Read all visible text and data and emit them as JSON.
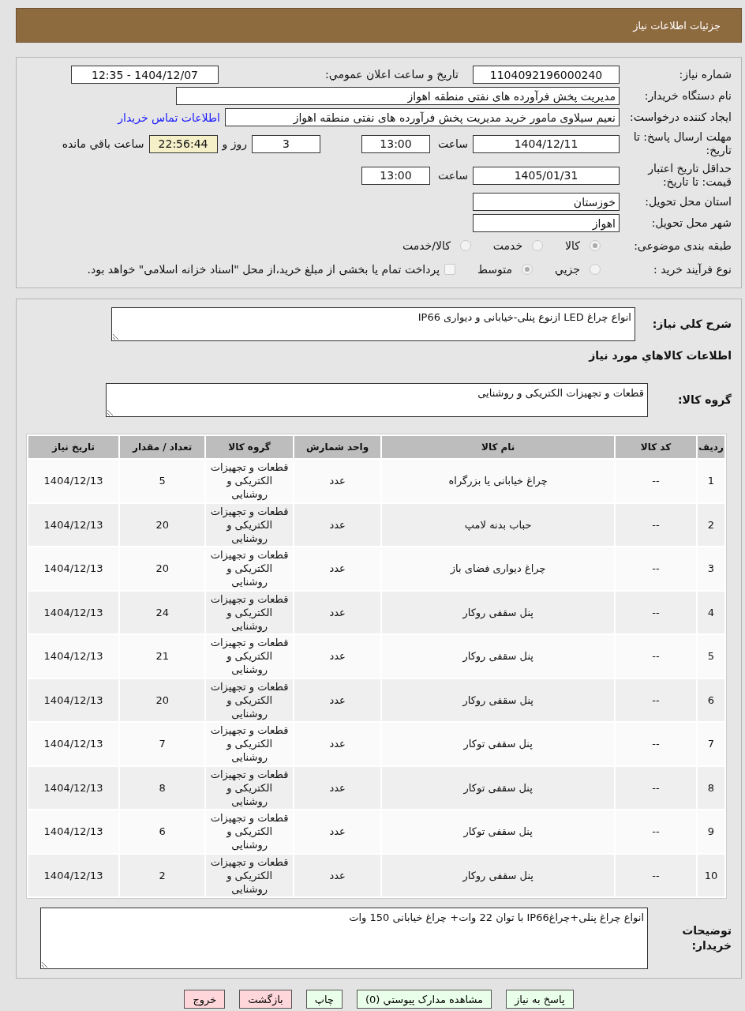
{
  "header": {
    "title": "جزئیات اطلاعات نیاز"
  },
  "need_number": {
    "label": "شماره نیاز:",
    "value": "1104092196000240"
  },
  "announce": {
    "label": "تاریخ و ساعت اعلان عمومي:",
    "value": "1404/12/07 - 12:35"
  },
  "buyer_org": {
    "label": "نام دستگاه خریدار:",
    "value": "مدیریت پخش فرآورده های نفتی منطقه اهواز"
  },
  "requester": {
    "label": "ایجاد کننده درخواست:",
    "value": "نعیم سیلاوی مامور خرید مدیریت پخش فرآورده های نفتی منطقه اهواز",
    "link": "اطلاعات تماس خریدار"
  },
  "deadline": {
    "label": "مهلت ارسال پاسخ: تا تاریخ:",
    "date": "1404/12/11",
    "time_label": "ساعت",
    "time": "13:00",
    "days": "3",
    "days_suffix": "روز و",
    "remaining": "22:56:44",
    "remaining_suffix": "ساعت باقي مانده"
  },
  "validity": {
    "label": "حداقل تاریخ اعتبار قیمت: تا تاریخ:",
    "date": "1405/01/31",
    "time_label": "ساعت",
    "time": "13:00"
  },
  "province": {
    "label": "استان محل تحویل:",
    "value": "خوزستان"
  },
  "city": {
    "label": "شهر محل تحویل:",
    "value": "اهواز"
  },
  "category": {
    "label": "طبقه بندی موضوعی:",
    "options": [
      {
        "label": "کالا",
        "selected": true
      },
      {
        "label": "خدمت",
        "selected": false
      },
      {
        "label": "کالا/خدمت",
        "selected": false
      }
    ]
  },
  "process": {
    "label": "نوع فرآیند خرید :",
    "options": [
      {
        "label": "جزيي",
        "selected": false
      },
      {
        "label": "متوسط",
        "selected": true
      }
    ],
    "checkbox": {
      "checked": false,
      "text": "پرداخت تمام یا بخشی از مبلغ خرید،از محل \"اسناد خزانه اسلامی\" خواهد بود."
    }
  },
  "description": {
    "label": "شرح کلي نیاز:",
    "value": "انواع چراغ LED ازنوع پنلی-خیابانی و دیواری IP66"
  },
  "items_title": "اطلاعات کالاهاي مورد نیاز",
  "goods_group": {
    "label": "گروه کالا:",
    "value": "قطعات و تجهیزات الکتریکی و روشنایی"
  },
  "table": {
    "columns": [
      "ردیف",
      "کد کالا",
      "نام کالا",
      "واحد شمارش",
      "گروه کالا",
      "تعداد / مقدار",
      "تاریخ نیاز"
    ],
    "rows": [
      [
        "1",
        "--",
        "چراغ خیابانی یا بزرگراه",
        "عدد",
        "قطعات و تجهیزات الکتریکی و روشنایی",
        "5",
        "1404/12/13"
      ],
      [
        "2",
        "--",
        "حباب بدنه لامپ",
        "عدد",
        "قطعات و تجهیزات الکتریکی و روشنایی",
        "20",
        "1404/12/13"
      ],
      [
        "3",
        "--",
        "چراغ دیواری فضای باز",
        "عدد",
        "قطعات و تجهیزات الکتریکی و روشنایی",
        "20",
        "1404/12/13"
      ],
      [
        "4",
        "--",
        "پنل سقفی روکار",
        "عدد",
        "قطعات و تجهیزات الکتریکی و روشنایی",
        "24",
        "1404/12/13"
      ],
      [
        "5",
        "--",
        "پنل سقفی روکار",
        "عدد",
        "قطعات و تجهیزات الکتریکی و روشنایی",
        "21",
        "1404/12/13"
      ],
      [
        "6",
        "--",
        "پنل سقفی روکار",
        "عدد",
        "قطعات و تجهیزات الکتریکی و روشنایی",
        "20",
        "1404/12/13"
      ],
      [
        "7",
        "--",
        "پنل سقفی توکار",
        "عدد",
        "قطعات و تجهیزات الکتریکی و روشنایی",
        "7",
        "1404/12/13"
      ],
      [
        "8",
        "--",
        "پنل سقفی توکار",
        "عدد",
        "قطعات و تجهیزات الکتریکی و روشنایی",
        "8",
        "1404/12/13"
      ],
      [
        "9",
        "--",
        "پنل سقفی توکار",
        "عدد",
        "قطعات و تجهیزات الکتریکی و روشنایی",
        "6",
        "1404/12/13"
      ],
      [
        "10",
        "--",
        "پنل سقفی روکار",
        "عدد",
        "قطعات و تجهیزات الکتریکی و روشنایی",
        "2",
        "1404/12/13"
      ]
    ]
  },
  "buyer_notes": {
    "label": "توضیحات خریدار:",
    "value": "انواع چراغ پنلی+چراغIP66 با توان 22 وات+ چراغ خیابانی 150 وات"
  },
  "buttons": [
    {
      "label": "پاسخ به نیاز",
      "kind": "action"
    },
    {
      "label": "مشاهده مدارک پیوستي (0)",
      "kind": "action"
    },
    {
      "label": "چاپ",
      "kind": "action"
    },
    {
      "label": "بازگشت",
      "kind": "exit"
    },
    {
      "label": "خروج",
      "kind": "exit"
    }
  ]
}
